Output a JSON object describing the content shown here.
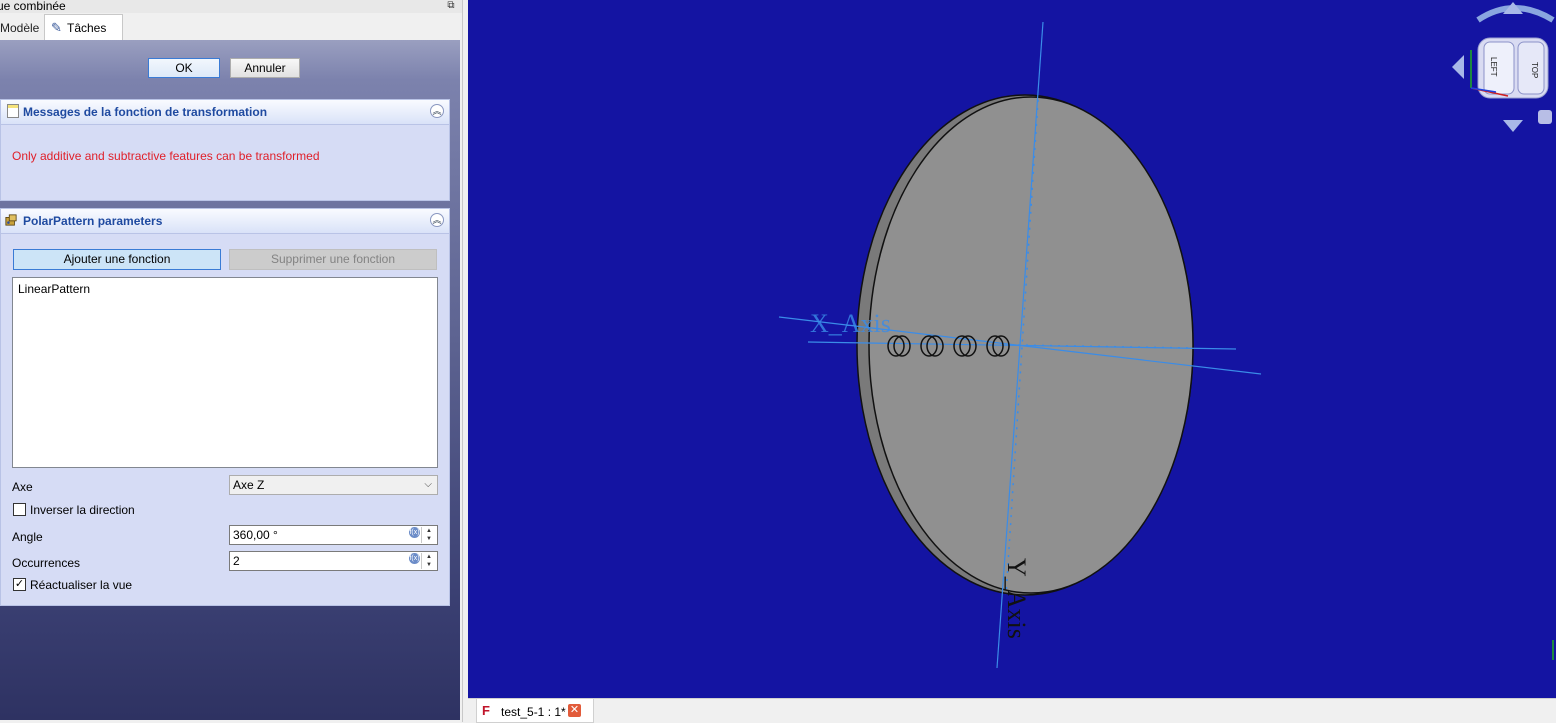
{
  "combo": {
    "title": "ue combinée",
    "tabs": [
      {
        "label": "Modèle"
      },
      {
        "label": "Tâches"
      }
    ]
  },
  "dialog": {
    "ok_label": "OK",
    "cancel_label": "Annuler"
  },
  "messages_panel": {
    "title": "Messages de la fonction de transformation",
    "message": "Only additive and subtractive features can be transformed",
    "message_color": "#e0202a"
  },
  "polar_panel": {
    "title": "PolarPattern parameters",
    "add_feature_label": "Ajouter une fonction",
    "remove_feature_label": "Supprimer une fonction",
    "features": [
      "LinearPattern"
    ],
    "axis_label": "Axe",
    "axis_value": "Axe Z",
    "reverse_label": "Inverser la direction",
    "reverse_checked": false,
    "angle_label": "Angle",
    "angle_value": "360,00 °",
    "occurrences_label": "Occurrences",
    "occurrences_value": "2",
    "refresh_label": "Réactualiser la vue",
    "refresh_checked": true
  },
  "viewer": {
    "background": "#1414a2",
    "x_axis_label": "X_Axis",
    "y_axis_label": "Y_Axis",
    "navcube_faces": [
      "LEFT",
      "TOP"
    ],
    "axis_color": "#3a8ce8",
    "disk_color": "#909090"
  },
  "document_tab": {
    "name": "test_5-1 : 1*"
  }
}
